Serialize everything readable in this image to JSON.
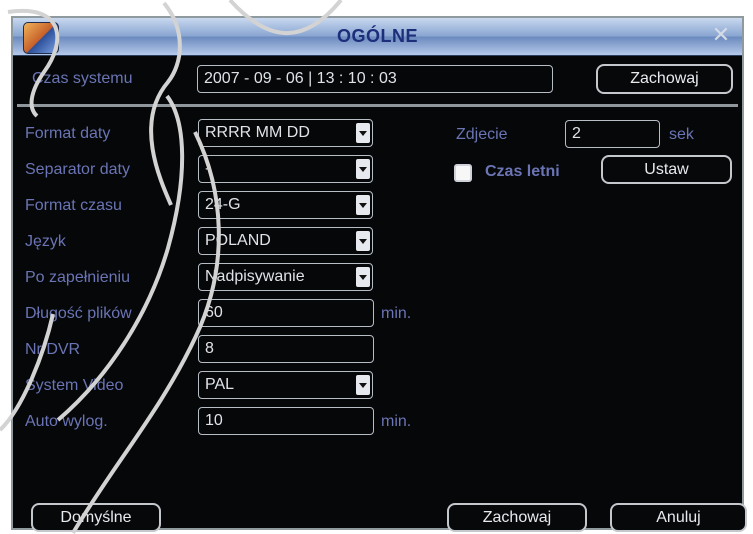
{
  "window": {
    "title": "OGÓLNE",
    "close_glyph": "✕"
  },
  "system_time": {
    "label": "Czas systemu",
    "value": "2007  -  09  -  06  | 13  :  10  :  03",
    "button": "Zachowaj"
  },
  "settings": [
    {
      "label": "Format daty",
      "value": "RRRR MM DD",
      "type": "select"
    },
    {
      "label": "Separator daty",
      "value": "-",
      "type": "select"
    },
    {
      "label": "Format czasu",
      "value": "24-G",
      "type": "select"
    },
    {
      "label": "Język",
      "value": "POLAND",
      "type": "select"
    },
    {
      "label": "Po zapełnieniu",
      "value": "Nadpisywanie",
      "type": "select"
    },
    {
      "label": "Długość plików",
      "value": "60",
      "unit": "min."
    },
    {
      "label": "Nr DVR",
      "value": "8"
    },
    {
      "label": "System Video",
      "value": "PAL",
      "type": "select"
    },
    {
      "label": "Auto wylog.",
      "value": "10",
      "unit": "min."
    }
  ],
  "right_panel": {
    "zdjecie_label": "Zdjecie",
    "zdjecie_value": "2",
    "zdjecie_unit": "sek",
    "czas_letni_label": "Czas letni",
    "czas_letni_checked": true,
    "ustaw_button": "Ustaw"
  },
  "footer": {
    "default_button": "Domyślne",
    "save_button": "Zachowaj",
    "cancel_button": "Anuluj"
  },
  "icons": {
    "app": "app-logo-icon",
    "close": "close-icon",
    "dropdown": "chevron-down-icon"
  }
}
